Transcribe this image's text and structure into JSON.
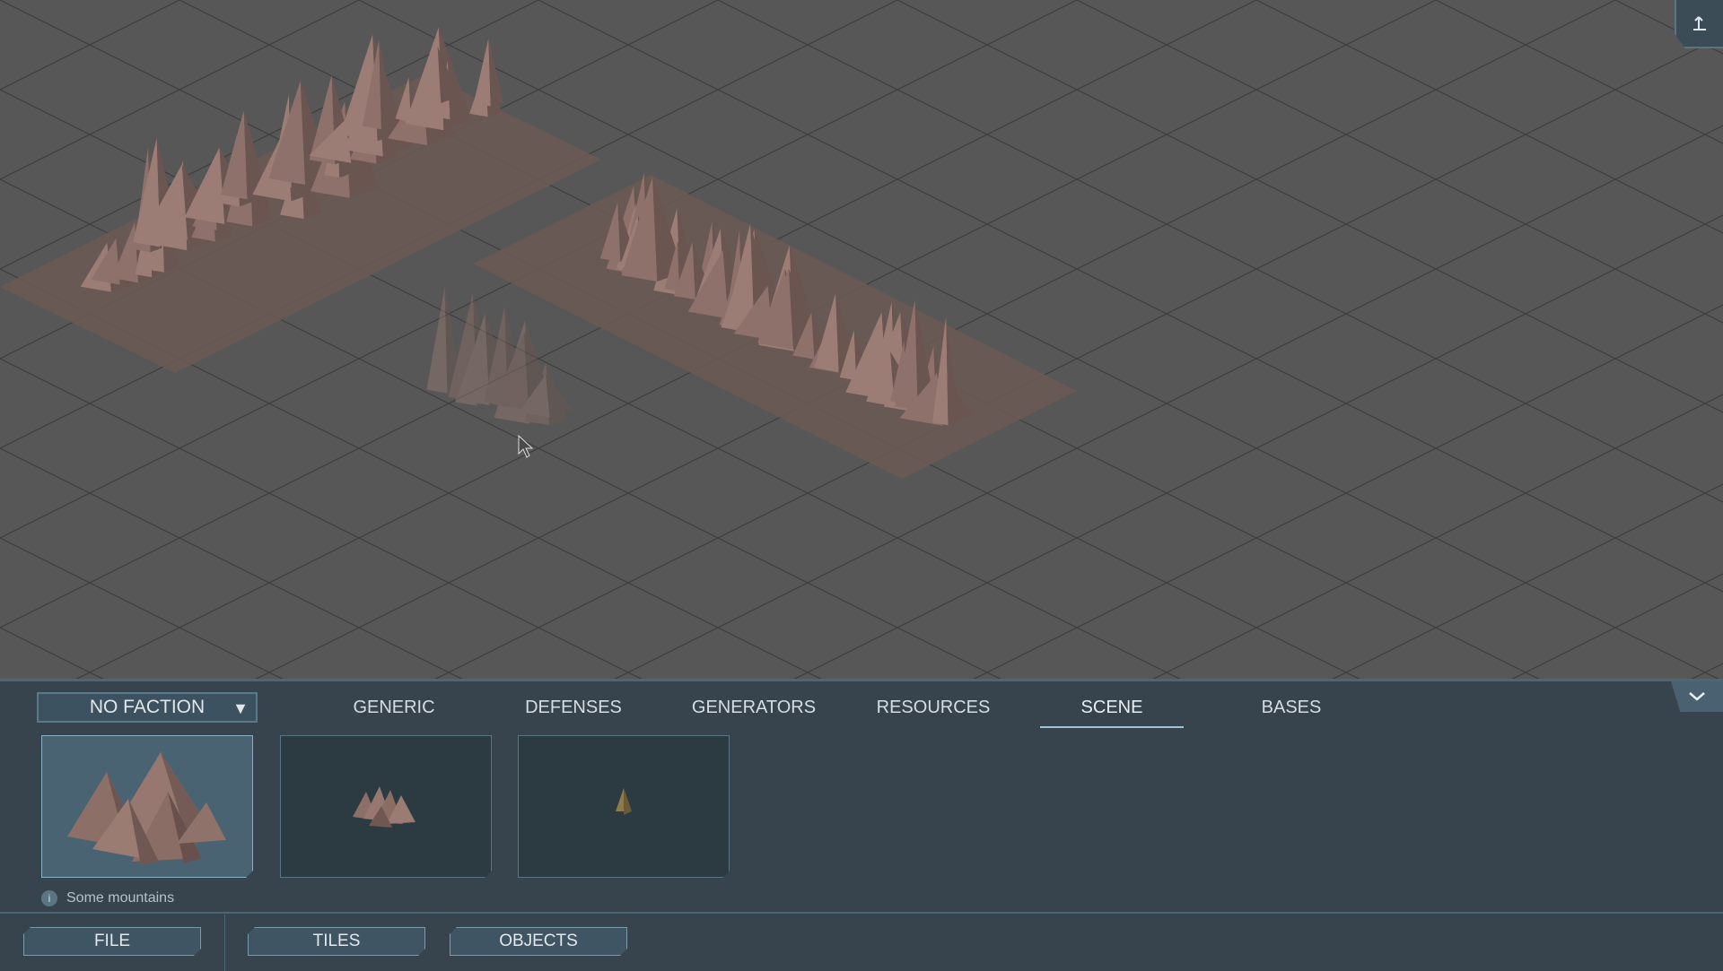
{
  "faction_selector": {
    "value": "NO FACTION"
  },
  "category_tabs": [
    {
      "label": "GENERIC"
    },
    {
      "label": "DEFENSES"
    },
    {
      "label": "GENERATORS"
    },
    {
      "label": "RESOURCES"
    },
    {
      "label": "SCENE",
      "active": true
    },
    {
      "label": "BASES"
    }
  ],
  "object_cards": [
    {
      "icon": "mountain-range-icon",
      "selected": true
    },
    {
      "icon": "small-mountains-icon",
      "selected": false
    },
    {
      "icon": "single-peak-icon",
      "selected": false
    }
  ],
  "info": {
    "text": "Some mountains",
    "icon_glyph": "i"
  },
  "bottom_nav": [
    {
      "label": "FILE"
    },
    {
      "label": "TILES"
    },
    {
      "label": "OBJECTS"
    }
  ],
  "colors": {
    "grid_background": "#575757",
    "panel": "#37444d",
    "accent": "#9fc4d8",
    "terrain": "#8a6c63"
  }
}
